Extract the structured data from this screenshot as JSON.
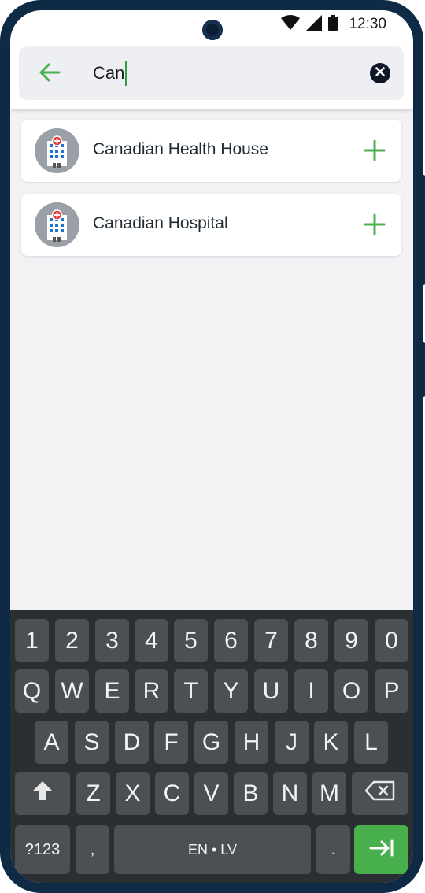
{
  "status_bar": {
    "time": "12:30",
    "icons": [
      "wifi-icon",
      "signal-icon",
      "battery-icon"
    ]
  },
  "search": {
    "query": "Can",
    "back_icon": "arrow-left-icon",
    "clear_icon": "close-circle-icon",
    "accent_color": "#4caf50"
  },
  "results": [
    {
      "name": "Canadian Health House",
      "icon": "hospital-icon",
      "action_icon": "plus-icon"
    },
    {
      "name": "Canadian Hospital",
      "icon": "hospital-icon",
      "action_icon": "plus-icon"
    }
  ],
  "keyboard": {
    "row_numbers": [
      "1",
      "2",
      "3",
      "4",
      "5",
      "6",
      "7",
      "8",
      "9",
      "0"
    ],
    "row_top": [
      "Q",
      "W",
      "E",
      "R",
      "T",
      "Y",
      "U",
      "I",
      "O",
      "P"
    ],
    "row_home": [
      "A",
      "S",
      "D",
      "F",
      "G",
      "H",
      "J",
      "K",
      "L"
    ],
    "row_bottom": [
      "Z",
      "X",
      "C",
      "V",
      "B",
      "N",
      "M"
    ],
    "shift_icon": "shift-arrow-icon",
    "backspace_icon": "backspace-icon",
    "symbols_label": "?123",
    "comma_label": ",",
    "space_label": "EN • LV",
    "period_label": ".",
    "enter_icon": "tab-next-icon",
    "enter_color": "#47b04c"
  }
}
